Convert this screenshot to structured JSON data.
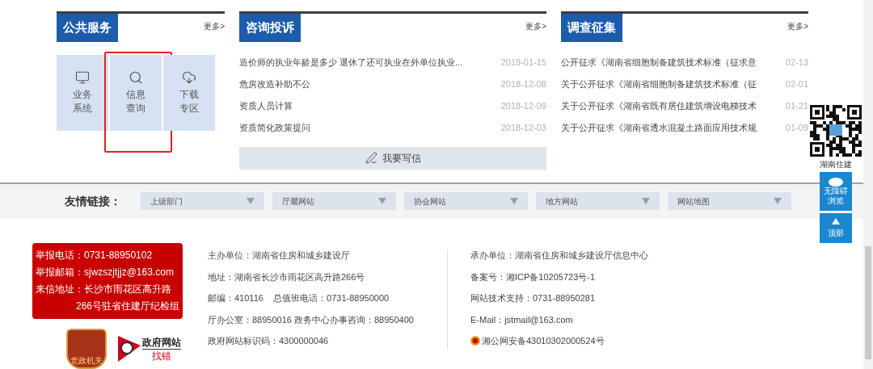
{
  "public_services": {
    "title": "公共服务",
    "more": "更多>",
    "tiles": [
      {
        "kind": "monitor",
        "lines": [
          "业务",
          "系统"
        ],
        "highlighted": false
      },
      {
        "kind": "search",
        "lines": [
          "信息",
          "查询"
        ],
        "highlighted": true
      },
      {
        "kind": "download",
        "lines": [
          "下载",
          "专区"
        ],
        "highlighted": false
      }
    ]
  },
  "consult": {
    "title": "咨询投诉",
    "more": "更多>",
    "items": [
      {
        "title": "造价师的执业年龄是多少 退休了还可执业在外单位执业...",
        "date": "2019-01-15"
      },
      {
        "title": "危房改造补助不公",
        "date": "2018-12-08"
      },
      {
        "title": "资质人员计算",
        "date": "2018-12-09"
      },
      {
        "title": "资质简化政策提问",
        "date": "2018-12-03"
      }
    ],
    "write_button": "我要写信"
  },
  "survey": {
    "title": "调查征集",
    "more": "更多>",
    "items": [
      {
        "title": "公开征求《湖南省细胞制备建筑技术标准（征求意",
        "date": "02-13"
      },
      {
        "title": "关于公开征求《湖南省细胞制备建筑技术标准（征",
        "date": "02-01"
      },
      {
        "title": "关于公开征求《湖南省既有居住建筑增设电梯技术",
        "date": "01-21"
      },
      {
        "title": "关于公开征求《湖南省透水混凝土路面应用技术规",
        "date": "01-09"
      }
    ]
  },
  "side_widgets": {
    "qr_caption": "湖南住建",
    "accessibility_button": [
      "无障碍",
      "浏览"
    ],
    "top_button": "顶部"
  },
  "friend_links": {
    "label": "友情链接：",
    "selects": [
      "上级部门",
      "厅屬网站",
      "协会网站",
      "地方网站",
      "网站地图"
    ]
  },
  "footer": {
    "report_lines": [
      "举报电话：0731-88950102",
      "举报邮箱：sjwzszjtjjz@163.com",
      "来信地址：长沙市雨花区高升路",
      "266号驻省住建厅纪检组"
    ],
    "party_badge": "党政机关",
    "error_logo": [
      "政府网站",
      "找错"
    ],
    "left_info": [
      "主办单位：湖南省住房和城乡建设厅",
      "地址：湖南省长沙市雨花区高升路266号",
      "邮编：410116    总值班电话：0731-88950000",
      "厅办公室：88950016 政务中心办事咨询：88950400",
      "政府网站标识码：4300000046"
    ],
    "right_info": [
      "承办单位：湖南省住房和城乡建设厅信息中心",
      "备案号：湘ICP备10205723号-1",
      "网站技术支持：0731-88950281",
      "E-Mail：jstmail@163.com"
    ],
    "police_record": "湘公网安备43010302000524号"
  }
}
